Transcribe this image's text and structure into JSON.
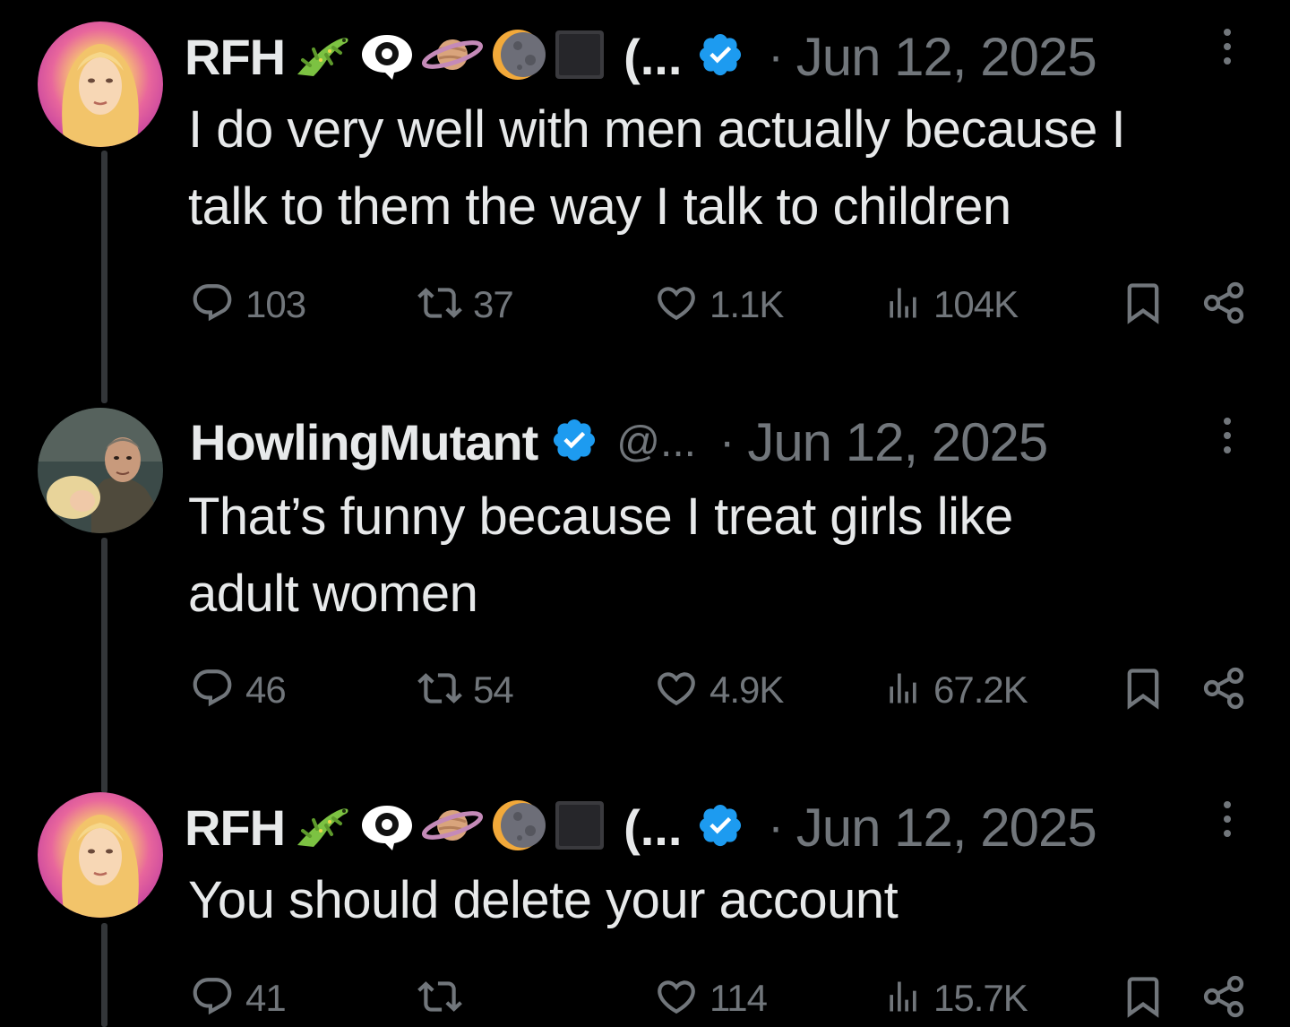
{
  "colors": {
    "background": "#000000",
    "text_primary": "#e7e9ea",
    "text_secondary": "#71767b",
    "verified_blue": "#1d9bf0",
    "thread_line": "#333639"
  },
  "tweets": [
    {
      "author_name": "RFH",
      "name_emojis": [
        "lizard-emoji",
        "eye-speech-bubble-emoji",
        "ringed-planet-emoji",
        "crescent-moon-emoji",
        "black-square-emoji"
      ],
      "name_truncation": "(...",
      "handle": "",
      "verified": true,
      "separator": "·",
      "date": "Jun 12, 2025",
      "text_lines": [
        "I do very well with men actually because I",
        "talk to them the way I talk to children"
      ],
      "replies": "103",
      "reposts": "37",
      "likes": "1.1K",
      "views": "104K"
    },
    {
      "author_name": "HowlingMutant",
      "name_emojis": [],
      "name_truncation": "",
      "handle": "@...",
      "verified": true,
      "separator": "·",
      "date": "Jun 12, 2025",
      "text_lines": [
        "That’s funny because I treat girls like",
        "adult women"
      ],
      "replies": "46",
      "reposts": "54",
      "likes": "4.9K",
      "views": "67.2K"
    },
    {
      "author_name": "RFH",
      "name_emojis": [
        "lizard-emoji",
        "eye-speech-bubble-emoji",
        "ringed-planet-emoji",
        "crescent-moon-emoji",
        "black-square-emoji"
      ],
      "name_truncation": "(...",
      "handle": "",
      "verified": true,
      "separator": "·",
      "date": "Jun 12, 2025",
      "text_lines": [
        "You should delete your account"
      ],
      "replies": "41",
      "reposts": "",
      "likes": "114",
      "views": "15.7K"
    }
  ]
}
